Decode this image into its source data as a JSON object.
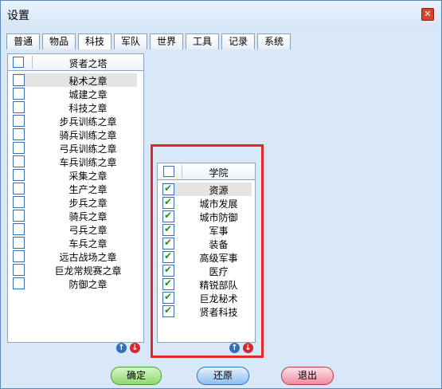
{
  "window": {
    "title": "设置",
    "close_label": "✕"
  },
  "tabs": [
    "普通",
    "物品",
    "科技",
    "军队",
    "世界",
    "工具",
    "记录",
    "系统"
  ],
  "active_tab": 2,
  "left_list": {
    "header": "贤者之塔",
    "items": [
      "秘术之章",
      "城建之章",
      "科技之章",
      "步兵训练之章",
      "骑兵训练之章",
      "弓兵训练之章",
      "车兵训练之章",
      "采集之章",
      "生产之章",
      "步兵之章",
      "骑兵之章",
      "弓兵之章",
      "车兵之章",
      "远古战场之章",
      "巨龙常规赛之章",
      "防御之章"
    ],
    "selected": 0
  },
  "right_list": {
    "header": "学院",
    "items": [
      "资源",
      "城市发展",
      "城市防御",
      "军事",
      "装备",
      "高级军事",
      "医疗",
      "精锐部队",
      "巨龙秘术",
      "贤者科技"
    ],
    "selected": 0
  },
  "buttons": {
    "ok": "确定",
    "reset": "还原",
    "exit": "退出"
  },
  "icons": {
    "up": "↑",
    "down": "↓"
  },
  "colors": {
    "highlight": "#e02a2a",
    "check": "#2a8a2a"
  }
}
